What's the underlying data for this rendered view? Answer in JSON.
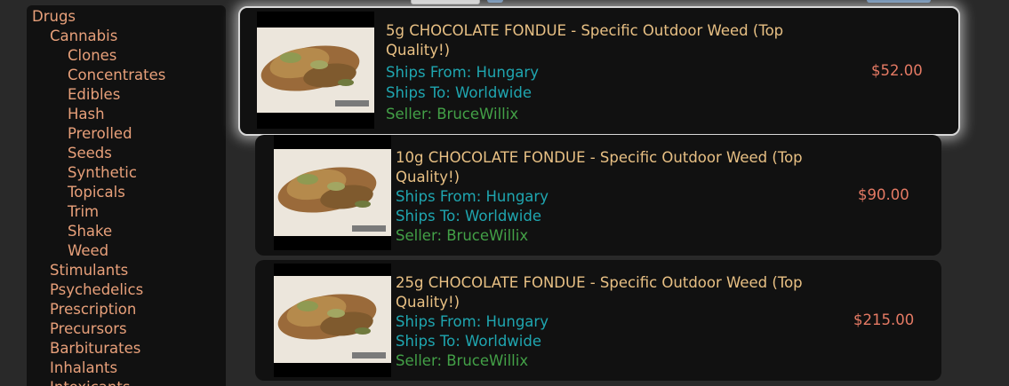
{
  "categories": [
    {
      "label": "Drugs",
      "level": 0
    },
    {
      "label": "Cannabis",
      "level": 1
    },
    {
      "label": "Clones",
      "level": 2
    },
    {
      "label": "Concentrates",
      "level": 2
    },
    {
      "label": "Edibles",
      "level": 2
    },
    {
      "label": "Hash",
      "level": 2
    },
    {
      "label": "Prerolled",
      "level": 2
    },
    {
      "label": "Seeds",
      "level": 2
    },
    {
      "label": "Synthetic",
      "level": 2
    },
    {
      "label": "Topicals",
      "level": 2
    },
    {
      "label": "Trim",
      "level": 2
    },
    {
      "label": "Shake",
      "level": 2
    },
    {
      "label": "Weed",
      "level": 2
    },
    {
      "label": "Stimulants",
      "level": 1
    },
    {
      "label": "Psychedelics",
      "level": 1
    },
    {
      "label": "Prescription",
      "level": 1
    },
    {
      "label": "Precursors",
      "level": 1
    },
    {
      "label": "Barbiturates",
      "level": 1
    },
    {
      "label": "Inhalants",
      "level": 1
    },
    {
      "label": "Intoxicants",
      "level": 1
    }
  ],
  "listings": [
    {
      "title": "5g CHOCOLATE FONDUE - Specific Outdoor Weed (Top Quality!)",
      "ships_from": "Ships From: Hungary",
      "ships_to": "Ships To: Worldwide",
      "seller": "Seller: BruceWillix",
      "price": "$52.00",
      "featured": true
    },
    {
      "title": "10g CHOCOLATE FONDUE - Specific Outdoor Weed (Top Quality!)",
      "ships_from": "Ships From: Hungary",
      "ships_to": "Ships To: Worldwide",
      "seller": "Seller: BruceWillix",
      "price": "$90.00",
      "featured": false
    },
    {
      "title": "25g CHOCOLATE FONDUE - Specific Outdoor Weed (Top Quality!)",
      "ships_from": "Ships From: Hungary",
      "ships_to": "Ships To: Worldwide",
      "seller": "Seller: BruceWillix",
      "price": "$215.00",
      "featured": false
    }
  ],
  "colors": {
    "category": "#e8a07a",
    "title": "#e8c084",
    "ships": "#1fa6b0",
    "seller": "#43a047",
    "price": "#e57a64"
  }
}
